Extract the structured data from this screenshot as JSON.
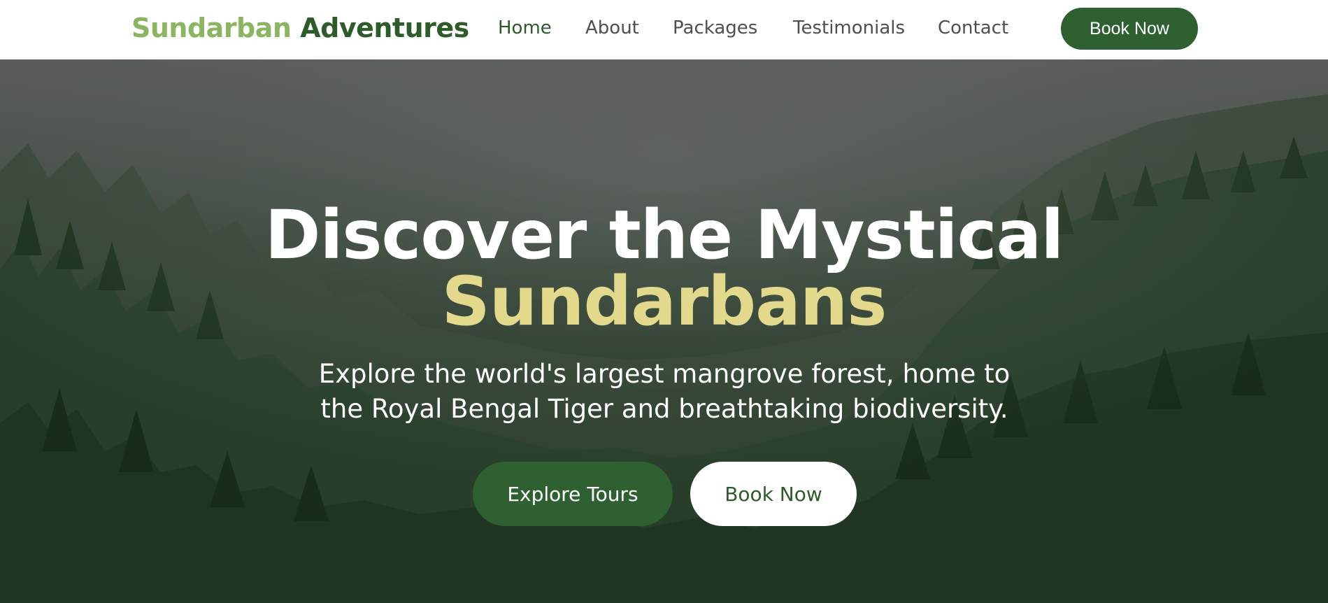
{
  "header": {
    "logo": {
      "part1": "Sundarban",
      "part2": "Adventures"
    },
    "nav": [
      {
        "label": "Home",
        "active": true
      },
      {
        "label": "About",
        "active": false
      },
      {
        "label": "Packages",
        "active": false
      },
      {
        "label": "Testimonials",
        "active": false
      },
      {
        "label": "Contact",
        "active": false
      }
    ],
    "cta_label": "Book Now"
  },
  "hero": {
    "title_line1": "Discover the Mystical",
    "title_line2": "Sundarbans",
    "subtitle": "Explore the world's largest mangrove forest, home to the Royal Bengal Tiger and breathtaking biodiversity.",
    "primary_button": "Explore Tours",
    "secondary_button": "Book Now",
    "background": "misty-pine-forest-photo"
  },
  "colors": {
    "brand_dark_green": "#2e6031",
    "logo_light_green": "#8bb560",
    "accent_gold": "#e3d98c",
    "white": "#ffffff"
  }
}
